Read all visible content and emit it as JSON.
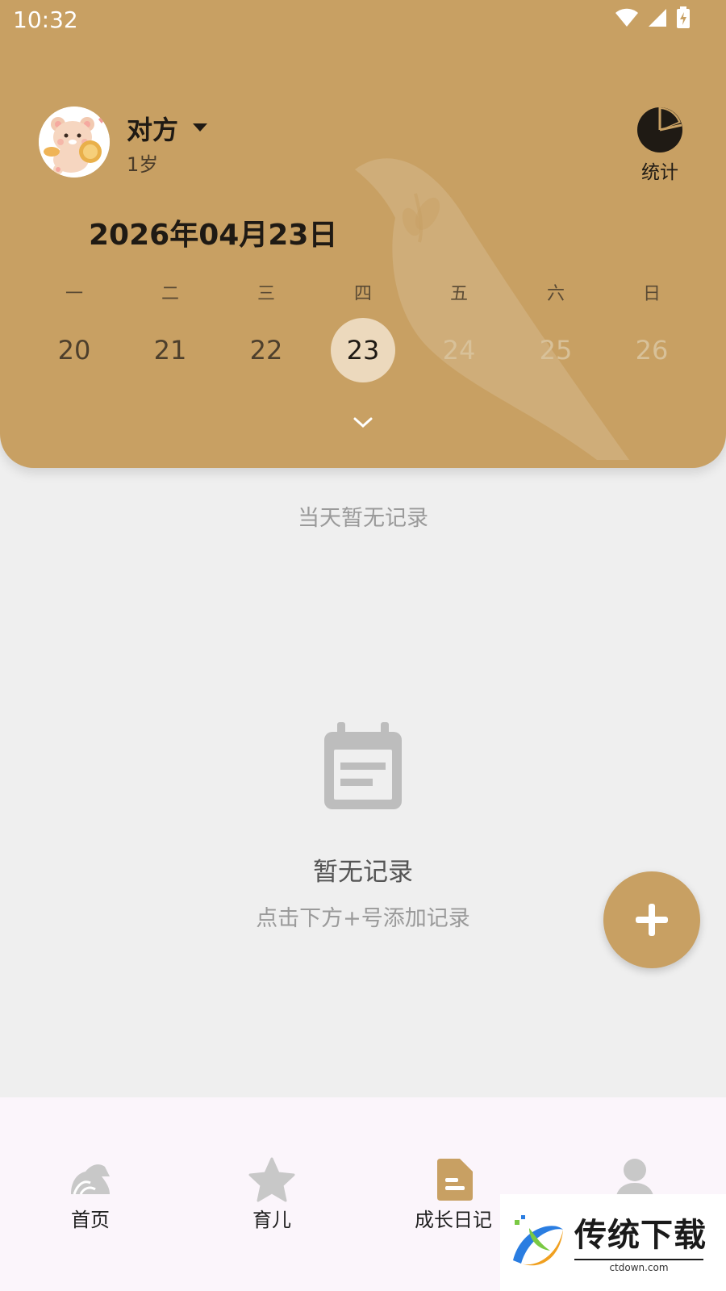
{
  "status_bar": {
    "time": "10:32"
  },
  "profile": {
    "name": "对方",
    "age": "1岁"
  },
  "stats": {
    "label": "统计"
  },
  "calendar": {
    "date_title": "2026年04月23日",
    "weekdays": [
      "一",
      "二",
      "三",
      "四",
      "五",
      "六",
      "日"
    ],
    "days": [
      "20",
      "21",
      "22",
      "23",
      "24",
      "25",
      "26"
    ],
    "selected_day": "23"
  },
  "records": {
    "day_empty_text": "当天暂无记录",
    "empty_title": "暂无记录",
    "empty_hint": "点击下方+号添加记录"
  },
  "bottom_nav": {
    "items": [
      {
        "label": "首页",
        "icon": "home-icon"
      },
      {
        "label": "育儿",
        "icon": "star-icon"
      },
      {
        "label": "成长日记",
        "icon": "diary-icon",
        "active": true
      },
      {
        "label": "",
        "icon": "profile-icon"
      }
    ]
  },
  "watermark": {
    "brand": "传统下载",
    "url": "ctdown.com"
  },
  "colors": {
    "accent": "#c8a063",
    "selected_day_bg": "#ecd9bd",
    "future_day": "#d8c199",
    "background": "#efefef",
    "nav_background": "#fbf5fb"
  }
}
